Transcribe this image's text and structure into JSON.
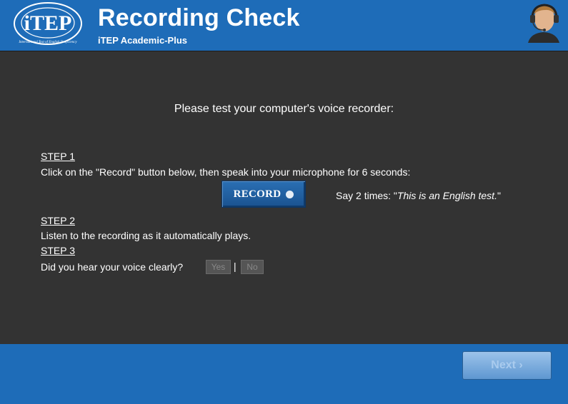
{
  "header": {
    "logo_text": "iTEP",
    "logo_ring_text": "International Test of English Proficiency",
    "title": "Recording Check",
    "subtitle": "iTEP Academic-Plus"
  },
  "main": {
    "instruction": "Please test your computer's voice recorder:",
    "step1": {
      "title": "STEP 1",
      "text": "Click on the \"Record\" button below, then speak into your microphone for 6 seconds:",
      "record_label": "RECORD",
      "say_prefix": "Say 2 times: \"",
      "say_phrase": "This is an English test.",
      "say_suffix": "\""
    },
    "step2": {
      "title": "STEP 2",
      "text": "Listen to the recording as it automatically plays."
    },
    "step3": {
      "title": "STEP 3",
      "text": "Did you hear your voice clearly?",
      "yes_label": "Yes",
      "separator": "|",
      "no_label": "No"
    }
  },
  "footer": {
    "next_label": "Next ›"
  },
  "colors": {
    "brand_blue": "#1e6cb8",
    "panel_bg": "#333333",
    "record_button": "#1a5a9a"
  },
  "icons": {
    "record": "record-dot-icon",
    "avatar": "headset-user-avatar"
  }
}
